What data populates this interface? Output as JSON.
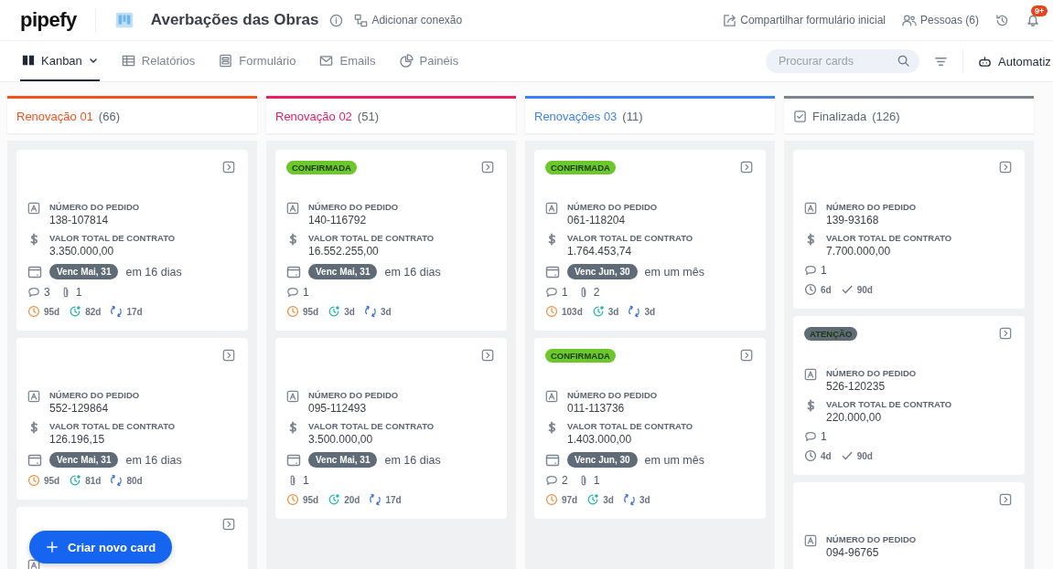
{
  "header": {
    "logo": "pipefy",
    "title": "Averbações das Obras",
    "connection_link": "Adicionar conexão",
    "share_link": "Compartilhar formulário inicial",
    "people_link": "Pessoas (6)",
    "notification_badge": "9+"
  },
  "tabs": [
    {
      "label": "Kanban",
      "kind": "kanban",
      "selected": true
    },
    {
      "label": "Relatórios",
      "kind": "table",
      "selected": false
    },
    {
      "label": "Formulário",
      "kind": "form",
      "selected": false
    },
    {
      "label": "Emails",
      "kind": "mail",
      "selected": false
    },
    {
      "label": "Painéis",
      "kind": "chart",
      "selected": false
    }
  ],
  "search": {
    "placeholder": "Procurar cards"
  },
  "automation_button": "Automatiz",
  "columns": [
    {
      "title": "Renovação 01",
      "count": "(66)",
      "color": "#f4511e",
      "kind": "phase",
      "cards": [
        {
          "fields": [
            {
              "kind": "text",
              "label": "NÚMERO DO PEDIDO",
              "value": "138-107814"
            },
            {
              "kind": "money",
              "label": "VALOR TOTAL DE CONTRATO",
              "value": "3.350.000,00"
            }
          ],
          "due": {
            "badge": "Venc Mai, 31",
            "relative": "em 16 dias"
          },
          "counts": [
            {
              "kind": "comment",
              "value": "3"
            },
            {
              "kind": "attachment",
              "value": "1"
            }
          ],
          "timers": [
            {
              "kind": "total",
              "value": "95d"
            },
            {
              "kind": "phase",
              "value": "82d"
            },
            {
              "kind": "updated",
              "value": "17d"
            }
          ]
        },
        {
          "fields": [
            {
              "kind": "text",
              "label": "NÚMERO DO PEDIDO",
              "value": "552-129864"
            },
            {
              "kind": "money",
              "label": "VALOR TOTAL DE CONTRATO",
              "value": "126.196,15"
            }
          ],
          "due": {
            "badge": "Venc Mai, 31",
            "relative": "em 16 dias"
          },
          "timers": [
            {
              "kind": "total",
              "value": "95d"
            },
            {
              "kind": "phase",
              "value": "81d"
            },
            {
              "kind": "updated",
              "value": "80d"
            }
          ]
        },
        {
          "fields": [
            {
              "kind": "text"
            }
          ]
        }
      ]
    },
    {
      "title": "Renovação 02",
      "count": "(51)",
      "color": "#e91e63",
      "kind": "phase",
      "cards": [
        {
          "tag": {
            "label": "CONFIRMADA",
            "color": "#6cc72b"
          },
          "fields": [
            {
              "kind": "text",
              "label": "NÚMERO DO PEDIDO",
              "value": "140-116792"
            },
            {
              "kind": "money",
              "label": "VALOR TOTAL DE CONTRATO",
              "value": "16.552.255,00"
            }
          ],
          "due": {
            "badge": "Venc Mai, 31",
            "relative": "em 16 dias"
          },
          "counts": [
            {
              "kind": "comment",
              "value": "1"
            }
          ],
          "timers": [
            {
              "kind": "total",
              "value": "95d"
            },
            {
              "kind": "phase",
              "value": "3d"
            },
            {
              "kind": "updated",
              "value": "3d"
            }
          ]
        },
        {
          "fields": [
            {
              "kind": "text",
              "label": "NÚMERO DO PEDIDO",
              "value": "095-112493"
            },
            {
              "kind": "money",
              "label": "VALOR TOTAL DE CONTRATO",
              "value": "3.500.000,00"
            }
          ],
          "due": {
            "badge": "Venc Mai, 31",
            "relative": "em 16 dias"
          },
          "counts": [
            {
              "kind": "attachment",
              "value": "1"
            }
          ],
          "timers": [
            {
              "kind": "total",
              "value": "95d"
            },
            {
              "kind": "phase",
              "value": "20d"
            },
            {
              "kind": "updated",
              "value": "17d"
            }
          ]
        }
      ]
    },
    {
      "title": "Renovações 03",
      "count": "(11)",
      "color": "#3b82f6",
      "kind": "phase",
      "cards": [
        {
          "tag": {
            "label": "CONFIRMADA",
            "color": "#6cc72b"
          },
          "fields": [
            {
              "kind": "text",
              "label": "NÚMERO DO PEDIDO",
              "value": "061-118204"
            },
            {
              "kind": "money",
              "label": "VALOR TOTAL DE CONTRATO",
              "value": "1.764.453,74"
            }
          ],
          "due": {
            "badge": "Venc Jun, 30",
            "relative": "em um mês"
          },
          "counts": [
            {
              "kind": "comment",
              "value": "1"
            },
            {
              "kind": "attachment",
              "value": "2"
            }
          ],
          "timers": [
            {
              "kind": "total",
              "value": "103d"
            },
            {
              "kind": "phase",
              "value": "3d"
            },
            {
              "kind": "updated",
              "value": "3d"
            }
          ]
        },
        {
          "tag": {
            "label": "CONFIRMADA",
            "color": "#6cc72b"
          },
          "fields": [
            {
              "kind": "text",
              "label": "NÚMERO DO PEDIDO",
              "value": "011-113736"
            },
            {
              "kind": "money",
              "label": "VALOR TOTAL DE CONTRATO",
              "value": "1.403.000,00"
            }
          ],
          "due": {
            "badge": "Venc Jun, 30",
            "relative": "em um mês"
          },
          "counts": [
            {
              "kind": "comment",
              "value": "2"
            },
            {
              "kind": "attachment",
              "value": "1"
            }
          ],
          "timers": [
            {
              "kind": "total",
              "value": "97d"
            },
            {
              "kind": "phase",
              "value": "3d"
            },
            {
              "kind": "updated",
              "value": "3d"
            }
          ]
        }
      ]
    },
    {
      "title": "Finalizada",
      "count": "(126)",
      "color": "#7d858c",
      "kind": "done",
      "cards": [
        {
          "fields": [
            {
              "kind": "text",
              "label": "NÚMERO DO PEDIDO",
              "value": "139-93168"
            },
            {
              "kind": "money",
              "label": "VALOR TOTAL DE CONTRATO",
              "value": "7.700.000,00"
            }
          ],
          "counts": [
            {
              "kind": "comment",
              "value": "1"
            }
          ],
          "timers": [
            {
              "kind": "clock",
              "value": "6d"
            },
            {
              "kind": "check",
              "value": "90d"
            }
          ]
        },
        {
          "tag": {
            "label": "ATENÇÃO",
            "color": "#5f6b76"
          },
          "fields": [
            {
              "kind": "text",
              "label": "NÚMERO DO PEDIDO",
              "value": "526-120235"
            },
            {
              "kind": "money",
              "label": "VALOR TOTAL DE CONTRATO",
              "value": "220.000,00"
            }
          ],
          "counts": [
            {
              "kind": "comment",
              "value": "1"
            }
          ],
          "timers": [
            {
              "kind": "clock",
              "value": "4d"
            },
            {
              "kind": "check",
              "value": "90d"
            }
          ]
        },
        {
          "fields": [
            {
              "kind": "text",
              "label": "NÚMERO DO PEDIDO",
              "value": "094-96765"
            }
          ]
        }
      ]
    }
  ],
  "create_button": "Criar novo card"
}
